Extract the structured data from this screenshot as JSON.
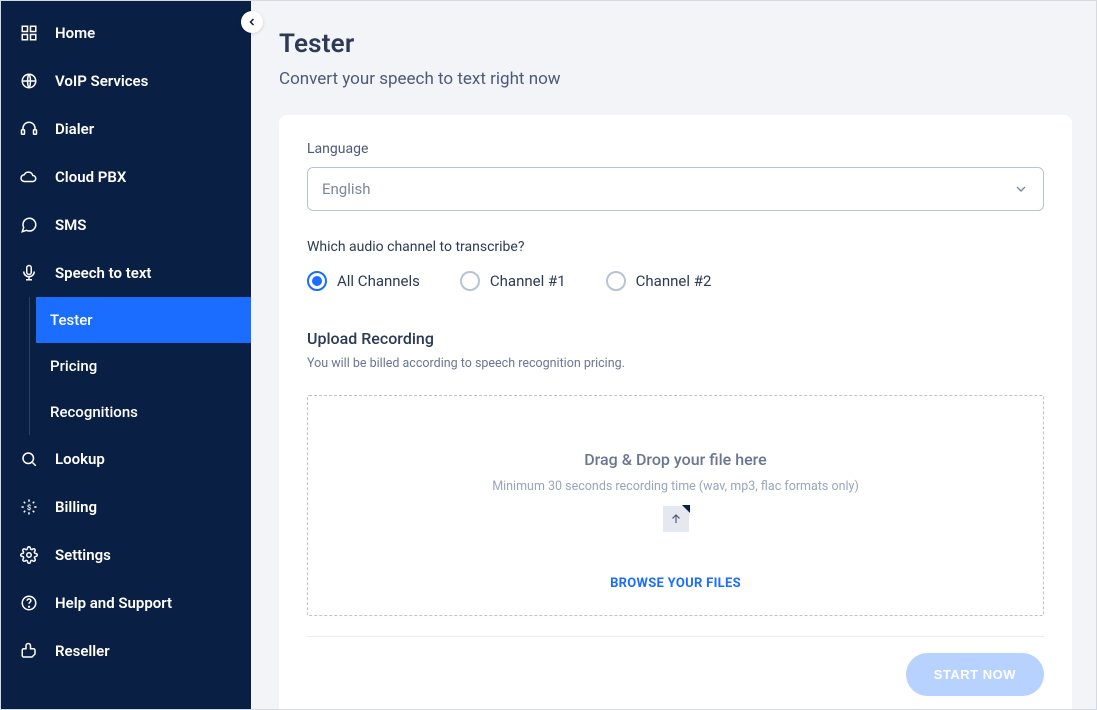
{
  "sidebar": {
    "items": [
      {
        "label": "Home",
        "icon": "grid-icon"
      },
      {
        "label": "VoIP Services",
        "icon": "globe-icon"
      },
      {
        "label": "Dialer",
        "icon": "headset-icon"
      },
      {
        "label": "Cloud PBX",
        "icon": "cloud-icon"
      },
      {
        "label": "SMS",
        "icon": "chat-icon"
      },
      {
        "label": "Speech to text",
        "icon": "mic-icon"
      },
      {
        "label": "Lookup",
        "icon": "search-icon"
      },
      {
        "label": "Billing",
        "icon": "wallet-icon"
      },
      {
        "label": "Settings",
        "icon": "gear-icon"
      },
      {
        "label": "Help and Support",
        "icon": "question-icon"
      },
      {
        "label": "Reseller",
        "icon": "thumb-icon"
      }
    ],
    "submenu": [
      {
        "label": "Tester"
      },
      {
        "label": "Pricing"
      },
      {
        "label": "Recognitions"
      }
    ]
  },
  "page": {
    "title": "Tester",
    "subtitle": "Convert your speech to text right now"
  },
  "form": {
    "language_label": "Language",
    "language_value": "English",
    "channel_question": "Which audio channel to transcribe?",
    "channels": [
      "All Channels",
      "Channel #1",
      "Channel #2"
    ],
    "upload_title": "Upload Recording",
    "upload_sub": "You will be billed according to speech recognition pricing.",
    "drop_title": "Drag & Drop your file here",
    "drop_sub": "Minimum 30 seconds recording time (wav, mp3, flac formats only)",
    "browse_label": "BROWSE YOUR FILES",
    "start_label": "START NOW"
  }
}
